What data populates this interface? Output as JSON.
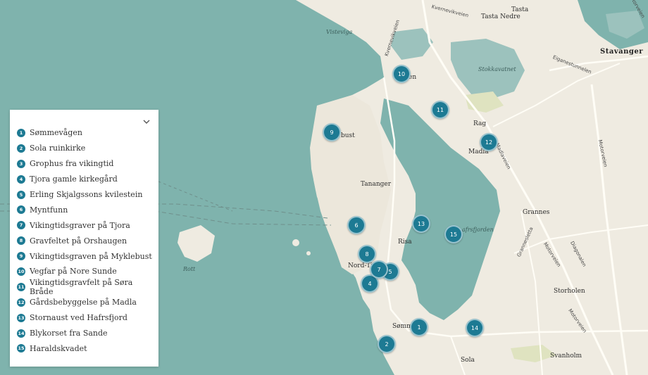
{
  "map": {
    "places": [
      {
        "key": "tasta",
        "text": "Tasta"
      },
      {
        "key": "tasta_nedre",
        "text": "Tasta Nedre"
      },
      {
        "key": "stavanger",
        "text": "Stavanger"
      },
      {
        "key": "rag",
        "text": "Rag"
      },
      {
        "key": "madla",
        "text": "Madla"
      },
      {
        "key": "busta",
        "text": "bust"
      },
      {
        "key": "tananger",
        "text": "Tananger"
      },
      {
        "key": "risa",
        "text": "Risa"
      },
      {
        "key": "nord_t",
        "text": "Nord-Tj"
      },
      {
        "key": "sommevagen",
        "text": "Sømm"
      },
      {
        "key": "sola",
        "text": "Sola"
      },
      {
        "key": "grannes",
        "text": "Grannes"
      },
      {
        "key": "storholen",
        "text": "Storholen"
      },
      {
        "key": "svanholm",
        "text": "Svanholm"
      },
      {
        "key": "nore_sunde",
        "text": "en"
      }
    ],
    "water_labels": [
      {
        "key": "visteviga",
        "text": "Visteviga"
      },
      {
        "key": "stokkavatnet",
        "text": "Stokkavatnet"
      },
      {
        "key": "hafrsfjorden",
        "text": "afrsfjorden"
      },
      {
        "key": "rott",
        "text": "Rott"
      }
    ],
    "road_labels": [
      {
        "key": "kvernevikveien",
        "text": "Kvernevikveien"
      },
      {
        "key": "kvernevikveien2",
        "text": "Kvernevikveien"
      },
      {
        "key": "eiganes",
        "text": "Eiganestunnelen"
      },
      {
        "key": "madlaveien",
        "text": "Madlaveien"
      },
      {
        "key": "motorveien1",
        "text": "Motorveien"
      },
      {
        "key": "motorveien2",
        "text": "Motorveien"
      },
      {
        "key": "motorveien3",
        "text": "Motorveien"
      },
      {
        "key": "grannesletta",
        "text": "Grannesletta"
      },
      {
        "key": "diagonalen",
        "text": "Diagonalen"
      },
      {
        "key": "motorveien4",
        "text": "Motorveien"
      }
    ],
    "markers": [
      "1",
      "2",
      "4",
      "5",
      "6",
      "7",
      "8",
      "9",
      "10",
      "11",
      "12",
      "13",
      "14",
      "15"
    ]
  },
  "legend": {
    "toggle_icon": "chevron-down-icon",
    "items": [
      {
        "num": "1",
        "label": "Sømmevågen"
      },
      {
        "num": "2",
        "label": "Sola ruinkirke"
      },
      {
        "num": "3",
        "label": "Grophus fra vikingtid"
      },
      {
        "num": "4",
        "label": "Tjora gamle kirkegård"
      },
      {
        "num": "5",
        "label": "Erling Skjalgssons kvilestein"
      },
      {
        "num": "6",
        "label": "Myntfunn"
      },
      {
        "num": "7",
        "label": "Vikingtidsgraver på Tjora"
      },
      {
        "num": "8",
        "label": "Gravfeltet på Orshaugen"
      },
      {
        "num": "9",
        "label": "Vikingtidsgraven på Myklebust"
      },
      {
        "num": "10",
        "label": "Vegfar på Nore Sunde"
      },
      {
        "num": "11",
        "label": "Vikingtidsgravfelt på Søra Bråde"
      },
      {
        "num": "12",
        "label": "Gårdsbebyggelse på Madla"
      },
      {
        "num": "13",
        "label": "Stornaust ved Hafrsfjord"
      },
      {
        "num": "14",
        "label": "Blykorset fra Sande"
      },
      {
        "num": "15",
        "label": "Haraldskvadet"
      }
    ]
  },
  "colors": {
    "water": "#7fb3ad",
    "land": "#efebe1",
    "marker": "#1d7a93",
    "park": "#dfe3c0"
  }
}
